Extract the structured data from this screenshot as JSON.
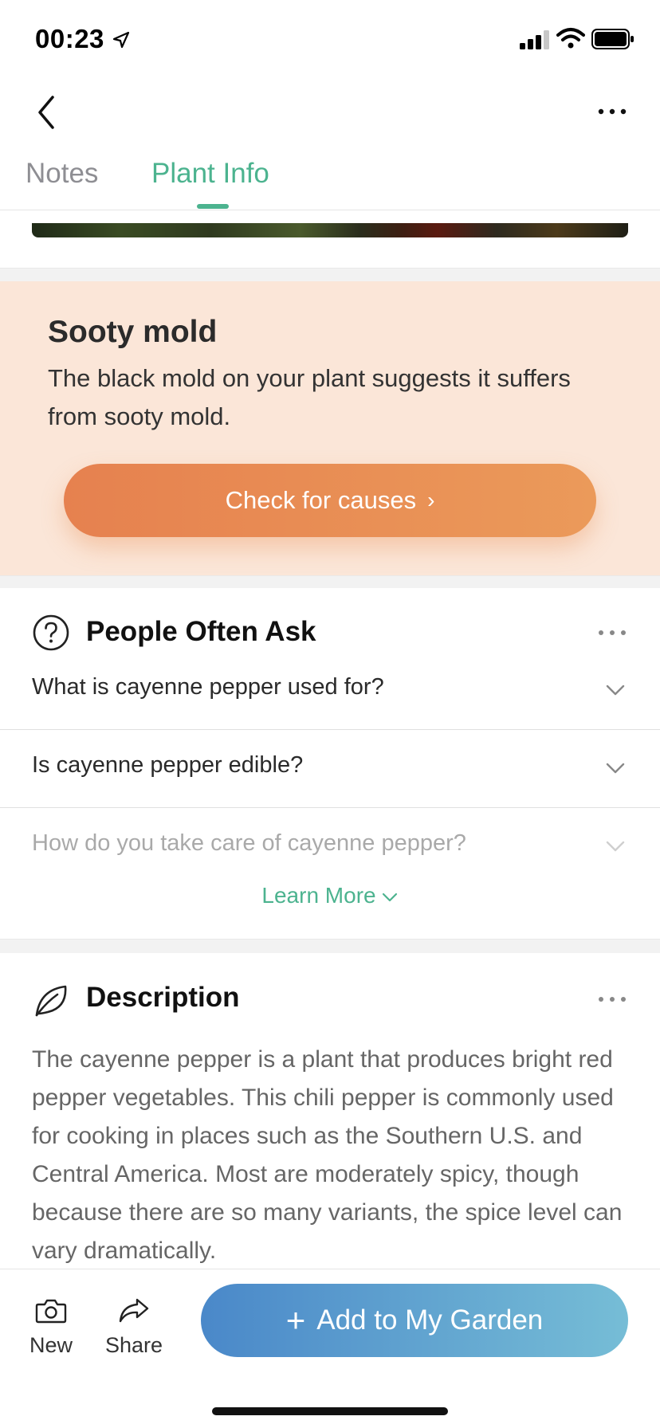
{
  "status_bar": {
    "time": "00:23"
  },
  "tabs": [
    {
      "label": "Notes",
      "active": false
    },
    {
      "label": "Plant Info",
      "active": true
    }
  ],
  "alert": {
    "title": "Sooty mold",
    "text": "The black mold on your plant suggests it suffers from sooty mold.",
    "button_label": "Check for causes",
    "button_chevron": "›"
  },
  "faq": {
    "title": "People Often Ask",
    "icon": "question-circle-icon",
    "questions": [
      "What is cayenne pepper used for?",
      "Is cayenne pepper edible?",
      "How do you take care of cayenne pepper?"
    ],
    "learn_more": "Learn More"
  },
  "description": {
    "title": "Description",
    "icon": "leaf-icon",
    "text": "The cayenne pepper is a plant that produces bright red pepper vegetables. This chili pepper is commonly used for cooking in places such as the Southern U.S. and Central America. Most are moderately spicy, though because there are so many variants, the spice level can vary dramatically."
  },
  "bottom_bar": {
    "new_label": "New",
    "share_label": "Share",
    "add_label": "Add to My Garden",
    "add_plus": "+"
  },
  "colors": {
    "accent_green": "#4cb38f",
    "alert_bg": "#fbe6d8",
    "alert_button": "#e6814f",
    "add_button_start": "#4a88c9",
    "add_button_end": "#76bdd6"
  }
}
